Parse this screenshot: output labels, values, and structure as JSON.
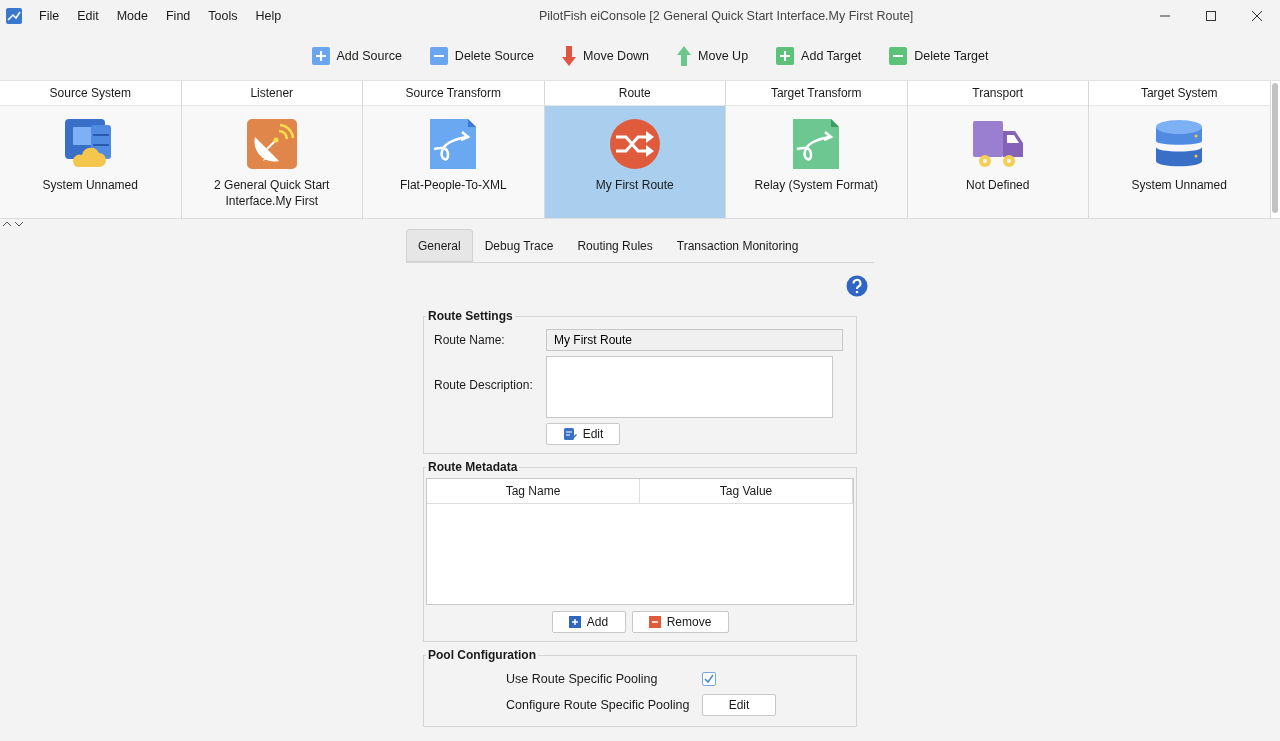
{
  "window": {
    "title": "PilotFish eiConsole [2 General Quick Start Interface.My First Route]"
  },
  "menu": [
    "File",
    "Edit",
    "Mode",
    "Find",
    "Tools",
    "Help"
  ],
  "toolbar": [
    {
      "label": "Add Source",
      "kind": "add",
      "color": "#6aa5f0"
    },
    {
      "label": "Delete Source",
      "kind": "remove",
      "color": "#6aa5f0"
    },
    {
      "label": "Move Down",
      "kind": "down",
      "color": "#e0553f"
    },
    {
      "label": "Move Up",
      "kind": "up",
      "color": "#6cc88a"
    },
    {
      "label": "Add Target",
      "kind": "add",
      "color": "#5cc27a"
    },
    {
      "label": "Delete Target",
      "kind": "remove",
      "color": "#5cc27a"
    }
  ],
  "stages": [
    {
      "heading": "Source System",
      "name": "System Unnamed",
      "kind": "system",
      "selected": false
    },
    {
      "heading": "Listener",
      "name": "2 General Quick Start Interface.My First",
      "kind": "listener",
      "selected": false
    },
    {
      "heading": "Source Transform",
      "name": "Flat-People-To-XML",
      "kind": "transform",
      "selected": false
    },
    {
      "heading": "Route",
      "name": "My First Route",
      "kind": "route",
      "selected": true
    },
    {
      "heading": "Target Transform",
      "name": "Relay (System Format)",
      "kind": "target-transform",
      "selected": false
    },
    {
      "heading": "Transport",
      "name": "Not Defined",
      "kind": "transport",
      "selected": false
    },
    {
      "heading": "Target System",
      "name": "System Unnamed",
      "kind": "database",
      "selected": false
    }
  ],
  "tabs": [
    {
      "label": "General",
      "selected": true
    },
    {
      "label": "Debug Trace",
      "selected": false
    },
    {
      "label": "Routing Rules",
      "selected": false
    },
    {
      "label": "Transaction Monitoring",
      "selected": false
    }
  ],
  "route_settings": {
    "title": "Route Settings",
    "name_label": "Route Name:",
    "name_value": "My First Route",
    "description_label": "Route Description:",
    "edit_button": "Edit"
  },
  "route_metadata": {
    "title": "Route Metadata",
    "columns": [
      "Tag Name",
      "Tag Value"
    ],
    "add_button": "Add",
    "remove_button": "Remove"
  },
  "pool_configuration": {
    "title": "Pool Configuration",
    "use_pooling_label": "Use Route Specific Pooling",
    "use_pooling_checked": true,
    "configure_label": "Configure Route Specific Pooling",
    "configure_button": "Edit"
  }
}
